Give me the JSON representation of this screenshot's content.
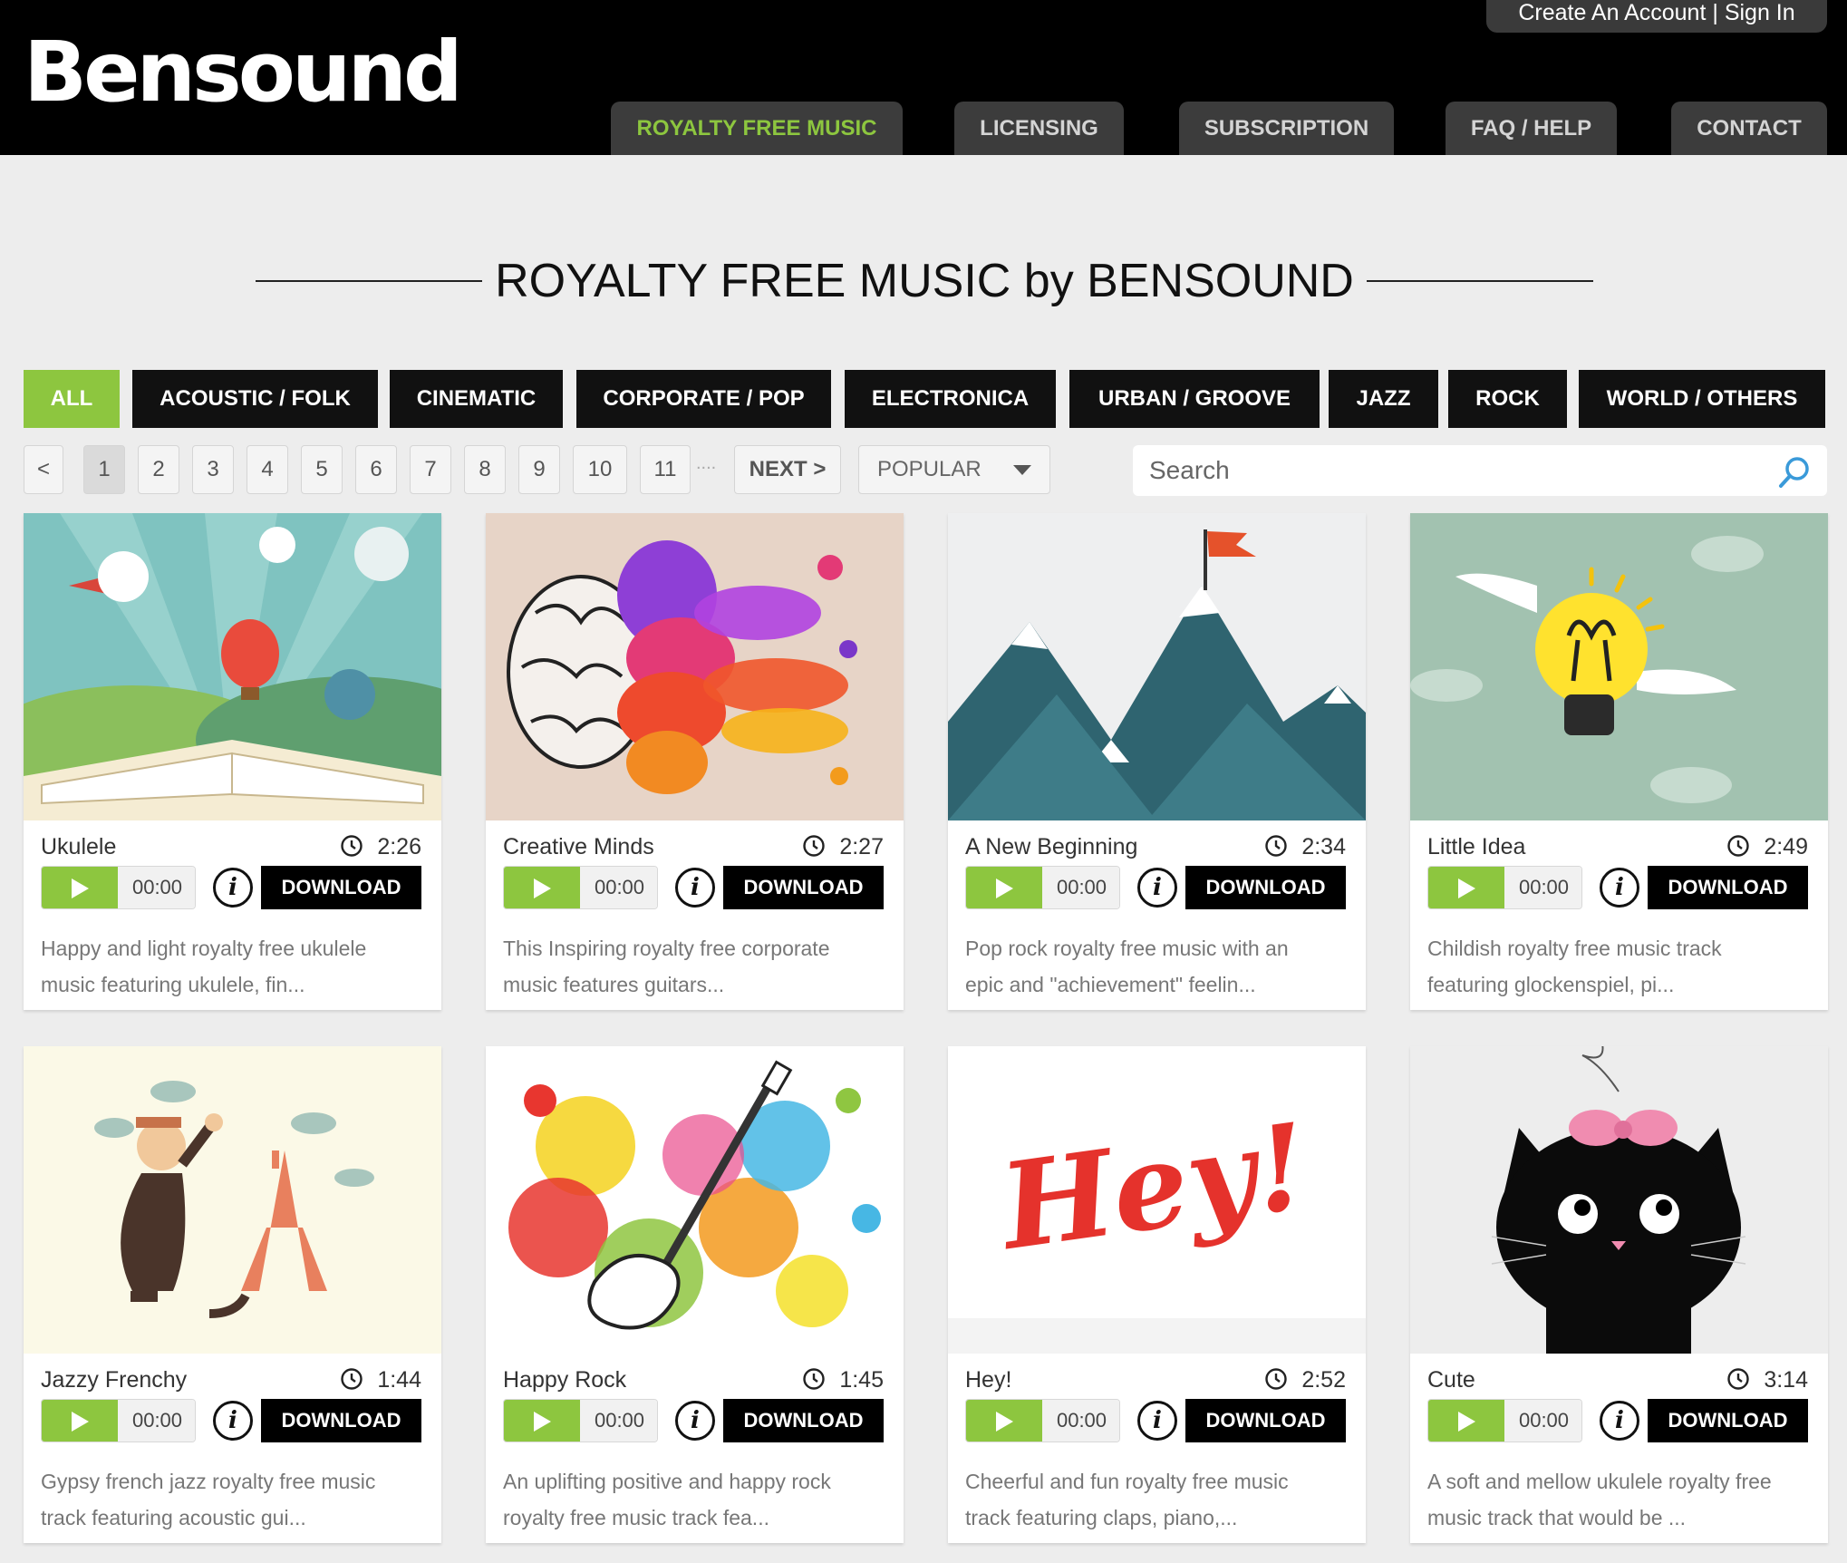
{
  "header": {
    "logo": "Bensound",
    "account": {
      "create": "Create An Account",
      "separator": " | ",
      "signin": "Sign In"
    },
    "nav": [
      {
        "label": "ROYALTY FREE MUSIC",
        "active": true
      },
      {
        "label": "LICENSING"
      },
      {
        "label": "SUBSCRIPTION"
      },
      {
        "label": "FAQ / HELP"
      },
      {
        "label": "CONTACT"
      }
    ]
  },
  "page_title": "ROYALTY FREE MUSIC by BENSOUND",
  "categories": [
    {
      "label": "ALL",
      "active": true
    },
    {
      "label": "ACOUSTIC / FOLK"
    },
    {
      "label": "CINEMATIC"
    },
    {
      "label": "CORPORATE / POP"
    },
    {
      "label": "ELECTRONICA"
    },
    {
      "label": "URBAN / GROOVE"
    },
    {
      "label": "JAZZ"
    },
    {
      "label": "ROCK"
    },
    {
      "label": "WORLD / OTHERS"
    }
  ],
  "pagination": {
    "prev": "<",
    "pages": [
      "1",
      "2",
      "3",
      "4",
      "5",
      "6",
      "7",
      "8",
      "9",
      "10",
      "11"
    ],
    "current": "1",
    "ellipsis": "....",
    "next": "NEXT >",
    "sort": "POPULAR"
  },
  "search": {
    "placeholder": "Search"
  },
  "colors": {
    "accent": "#8dc63f",
    "header_bg": "#000000",
    "tab_bg": "#3c3c3c"
  },
  "tracks": [
    {
      "title": "Ukulele",
      "duration": "2:26",
      "time": "00:00",
      "download": "DOWNLOAD",
      "desc1": "Happy and light royalty free ukulele",
      "desc2": "music featuring ukulele, fin..."
    },
    {
      "title": "Creative Minds",
      "duration": "2:27",
      "time": "00:00",
      "download": "DOWNLOAD",
      "desc1": "This Inspiring royalty free corporate",
      "desc2": "music features guitars..."
    },
    {
      "title": "A New Beginning",
      "duration": "2:34",
      "time": "00:00",
      "download": "DOWNLOAD",
      "desc1": "Pop rock royalty free music with an",
      "desc2": "epic and \"achievement\" feelin..."
    },
    {
      "title": "Little Idea",
      "duration": "2:49",
      "time": "00:00",
      "download": "DOWNLOAD",
      "desc1": "Childish royalty free music track",
      "desc2": "featuring glockenspiel, pi..."
    },
    {
      "title": "Jazzy Frenchy",
      "duration": "1:44",
      "time": "00:00",
      "download": "DOWNLOAD",
      "desc1": "Gypsy french jazz royalty free music",
      "desc2": "track featuring acoustic gui..."
    },
    {
      "title": "Happy Rock",
      "duration": "1:45",
      "time": "00:00",
      "download": "DOWNLOAD",
      "desc1": "An uplifting positive and happy rock",
      "desc2": "royalty free music track fea..."
    },
    {
      "title": "Hey!",
      "duration": "2:52",
      "time": "00:00",
      "download": "DOWNLOAD",
      "desc1": "Cheerful and fun royalty free music",
      "desc2": "track featuring claps, piano,..."
    },
    {
      "title": "Cute",
      "duration": "3:14",
      "time": "00:00",
      "download": "DOWNLOAD",
      "desc1": "A soft and mellow ukulele royalty free",
      "desc2": "music track that would be ..."
    }
  ],
  "artwork": {
    "hey_lettering": "Hey!"
  }
}
